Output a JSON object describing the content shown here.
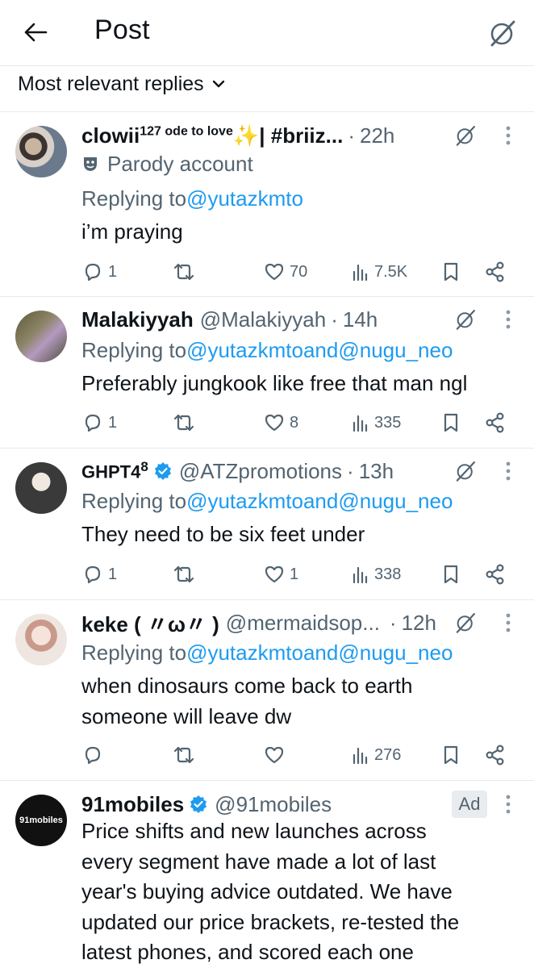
{
  "header": {
    "title": "Post"
  },
  "sort": {
    "label": "Most relevant replies"
  },
  "replies": [
    {
      "name": "clowii",
      "name_sup": "127",
      "name_suffix": " ode to love",
      "name_tail": "| #briiz...",
      "time": "22h",
      "parody_label": "Parody account",
      "replying_prefix": "Replying to ",
      "mention1": "@yutazkmto",
      "text": "i’m praying",
      "replies_count": "1",
      "likes": "70",
      "views": "7.5K"
    },
    {
      "name": "Malakiyyah",
      "handle": "@Malakiyyah",
      "time": "14h",
      "replying_prefix": "Replying to ",
      "mention1": "@yutazkmto",
      "joiner": " and ",
      "mention2": "@nugu_neo",
      "text": "Preferably jungkook like free that man ngl",
      "replies_count": "1",
      "likes": "8",
      "views": "335"
    },
    {
      "name": "GHPT4",
      "name_sup": "8",
      "handle": "@ATZpromotions",
      "time": "13h",
      "replying_prefix": "Replying to ",
      "mention1": "@yutazkmto",
      "joiner": " and ",
      "mention2": "@nugu_neo",
      "text": "They need to be six feet under",
      "replies_count": "1",
      "likes": "1",
      "views": "338"
    },
    {
      "name": "keke ( 〃ω〃 )",
      "handle": "@mermaidsop...",
      "time": "12h",
      "replying_prefix": "Replying to ",
      "mention1": "@yutazkmto",
      "joiner": " and ",
      "mention2": "@nugu_neo",
      "text_line1": "when dinosaurs come back to earth",
      "text_line2": "someone will leave dw",
      "views": "276"
    }
  ],
  "ad": {
    "name": "91mobiles",
    "handle": "@91mobiles",
    "badge": "Ad",
    "avatar_label": "91mobiles",
    "lines": [
      "Price shifts and new launches across",
      "every segment have made a lot of last",
      "year's buying advice outdated. We have",
      "updated our price brackets, re-tested the",
      "latest phones, and scored each one"
    ]
  },
  "colors": {
    "accent": "#1d9bf0",
    "muted": "#536471",
    "text": "#0f1419",
    "divider": "#e6e9ec"
  },
  "icons": [
    "back-arrow-icon",
    "grok-icon",
    "chevron-down-icon",
    "more-icon",
    "reply-icon",
    "repost-icon",
    "like-icon",
    "views-icon",
    "bookmark-icon",
    "share-icon",
    "verified-icon",
    "parody-mask-icon",
    "sparkle-emoji"
  ]
}
